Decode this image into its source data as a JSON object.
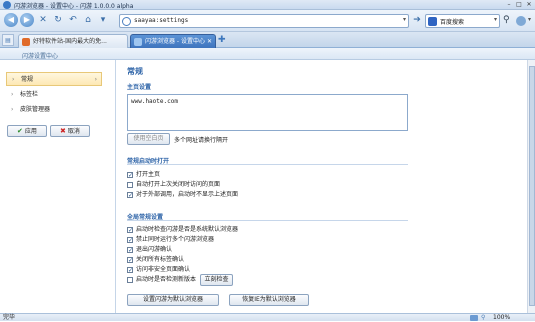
{
  "window": {
    "title": "闪游浏览器 - 设置中心 - 闪游 1.0.0.0 alpha"
  },
  "address": {
    "value": "saayaa:settings"
  },
  "search": {
    "engine": "百度搜索"
  },
  "tabs": [
    {
      "label": "好特软件站-国内最大的免..."
    },
    {
      "label": "闪游浏览器 - 设置中心"
    }
  ],
  "page_header": "闪游设置中心",
  "sidebar": {
    "items": [
      {
        "label": "常规"
      },
      {
        "label": "标签栏"
      },
      {
        "label": "皮肤管理器"
      }
    ],
    "apply_label": "应用",
    "cancel_label": "取消"
  },
  "main": {
    "title": "常规",
    "homepage": {
      "heading": "主页设置",
      "value": "www.haote.com",
      "use_blank_label": "使用空白页",
      "hint": "多个网址请换行隔开"
    },
    "startup": {
      "heading": "常规启动时打开",
      "options": [
        {
          "label": "打开主页",
          "checked": true
        },
        {
          "label": "自动打开上次关闭时访问的页面",
          "checked": false
        },
        {
          "label": "对于外部调用，启动时不显示上述页面",
          "checked": true
        }
      ]
    },
    "global": {
      "heading": "全局常规设置",
      "options": [
        {
          "label": "启动时检查闪游是否是系统默认浏览器",
          "checked": true
        },
        {
          "label": "禁止同时运行多个闪游浏览器",
          "checked": true
        },
        {
          "label": "退出闪游确认",
          "checked": true
        },
        {
          "label": "关闭所有标签确认",
          "checked": true
        },
        {
          "label": "访问非安全页面确认",
          "checked": true
        },
        {
          "label": "启动时是否检测新版本",
          "checked": false
        }
      ],
      "check_now_label": "立刻检查",
      "set_default_label": "设置闪游为默认浏览器",
      "restore_ie_label": "恢复IE为默认浏览器"
    }
  },
  "status": {
    "text": "完毕",
    "zoom": "100%"
  },
  "colors": {
    "accent": "#2e64a8",
    "tab_active": "#3e74bd"
  }
}
